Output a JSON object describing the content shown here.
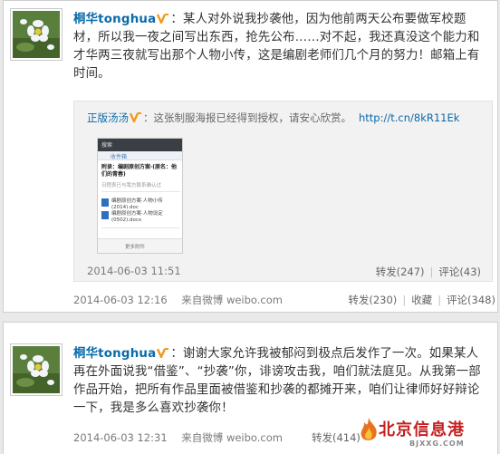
{
  "posts": [
    {
      "username": "桐华tonghua",
      "text": "：某人对外说我抄袭他，因为他前两天公布要做军校题材，所以我一夜之间写出东西，抢先公布……对不起，我还真没这个能力和才华两三夜就写出那个人物小传，这是编剧老师们几个月的努力！邮箱上有时间。",
      "repost": {
        "user": "正版汤汤",
        "text": "：这张制服海报已经得到授权，请安心欣赏。",
        "link": "http://t.cn/8kR11Ek",
        "time": "2014-06-03 11:51",
        "repost_label": "转发(247)",
        "comment_label": "评论(43)",
        "phone": {
          "search_text": "搜索",
          "inbox_label": "收件箱",
          "subject": "附录：编剧原创方案·(原名：他们的青春)",
          "preview": "日程表已与我方联系确认过",
          "file1": "编剧原创方案·人物小传(2014).doc",
          "file2": "编剧原创方案·人物设定(0502).docx",
          "footer": "更多附件"
        }
      },
      "time": "2014-06-03 12:16",
      "source_prefix": "来自",
      "source": "微博 weibo.com",
      "repost_label": "转发(230)",
      "fav_label": "收藏",
      "comment_label": "评论(348)"
    },
    {
      "username": "桐华tonghua",
      "text": "：谢谢大家允许我被郁闷到极点后发作了一次。如果某人再在外面说我“借鉴”、“抄袭”你，诽谤攻击我，咱们就法庭见。从我第一部作品开始，把所有作品里面被借鉴和抄袭的都摊开来，咱们让律师好好辩论一下，我是多么喜欢抄袭你！",
      "time": "2014-06-03 12:31",
      "source_prefix": "来自",
      "source": "微博 weibo.com",
      "repost_label": "转发(414)"
    }
  ],
  "watermark": {
    "main": "北京信息港",
    "sub": "BJXXG.COM"
  },
  "colors": {
    "link": "#0a6aa8",
    "badge": "#f39a1c",
    "watermark": "#c42020"
  }
}
